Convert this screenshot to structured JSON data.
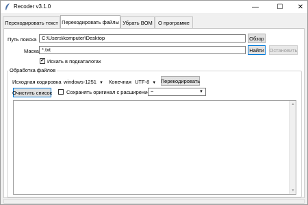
{
  "window": {
    "title": "Recoder v3.1.0",
    "minimize": "—",
    "maximize": "☐",
    "close": "✕"
  },
  "tabs": [
    {
      "label": "Перекодировать текст",
      "active": false
    },
    {
      "label": "Перекодировать файлы",
      "active": true
    },
    {
      "label": "Убрать BOM",
      "active": false
    },
    {
      "label": "О программе",
      "active": false
    }
  ],
  "search": {
    "path_label": "Путь поиска",
    "path_value": "C:\\Users\\komputer\\Desktop",
    "browse_label": "Обзор",
    "mask_label": "Маска",
    "mask_value": "*.txt",
    "find_label": "Найти",
    "stop_label": "Остановить",
    "subdirs_label": "Искать в подкаталогах",
    "subdirs_checked": "✔"
  },
  "processing": {
    "group_title": "Обработка файлов",
    "source_enc_label": "Исходная кодировка",
    "source_enc_value": "windows-1251",
    "target_enc_label": "Конечная",
    "target_enc_value": "UTF-8",
    "recode_label": "Перекодировать",
    "clear_label": "Очистить список",
    "keep_original_label": "Сохранять оригинал с расширением",
    "ext_value": "~",
    "arrow": "▼"
  },
  "scroll": {
    "up": "▲",
    "down": "▼"
  }
}
